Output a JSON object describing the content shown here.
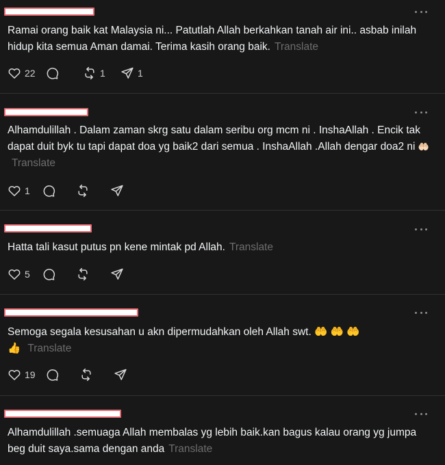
{
  "translate_label": "Translate",
  "posts": [
    {
      "text": "Ramai orang baik kat Malaysia ni... Patutlah Allah berkahkan tanah air ini.. asbab inilah hidup kita semua Aman damai. Terima kasih orang baik.",
      "emoji": "",
      "likes": "22",
      "replies": "",
      "reposts": "1",
      "shares": "1"
    },
    {
      "text": "Alhamdulillah . Dalam zaman skrg satu dalam seribu org mcm ni . InshaAllah . Encik tak dapat duit byk tu tapi dapat doa yg baik2 dari semua . InshaAllah .Allah dengar doa2 ni",
      "emoji": "🤲🏻",
      "likes": "1",
      "replies": "",
      "reposts": "",
      "shares": ""
    },
    {
      "text": "Hatta tali kasut putus pn kene mintak pd Allah.",
      "emoji": "",
      "likes": "5",
      "replies": "",
      "reposts": "",
      "shares": ""
    },
    {
      "text": "Semoga segala kesusahan u akn dipermudahkan oleh Allah swt. 🤲 🤲 🤲",
      "emoji": "👍",
      "likes": "19",
      "replies": "",
      "reposts": "",
      "shares": ""
    },
    {
      "text": "Alhamdulillah .semuaga Allah membalas yg lebih baik.kan bagus kalau orang yg jumpa beg duit saya.sama dengan anda",
      "emoji": "",
      "likes": "",
      "replies": "",
      "reposts": "",
      "shares": ""
    }
  ]
}
